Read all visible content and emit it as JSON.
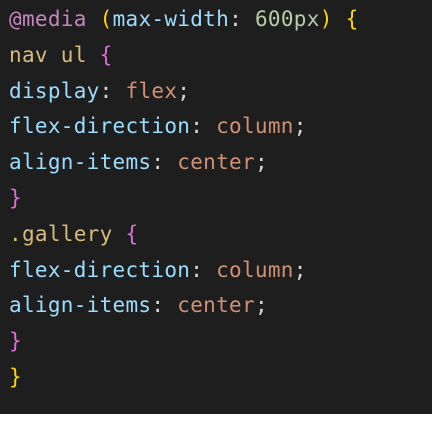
{
  "colors": {
    "background": "#1e1e1e",
    "keyword": "#c586c0",
    "property": "#9cdcfe",
    "selector": "#d7ba7d",
    "tag": "#d7ba7d",
    "value": "#ce9178",
    "number": "#b5cea8",
    "punctuation": "#d4d4d4",
    "brace_gold": "#ffd700",
    "brace_purple": "#da70d6"
  },
  "code_lines": [
    [
      {
        "text": "@media",
        "color": "#c586c0"
      },
      {
        "text": " ",
        "color": "#d4d4d4"
      },
      {
        "text": "(",
        "color": "#ffd700"
      },
      {
        "text": "max-width",
        "color": "#9cdcfe"
      },
      {
        "text": ": ",
        "color": "#d4d4d4"
      },
      {
        "text": "600px",
        "color": "#b5cea8"
      },
      {
        "text": ")",
        "color": "#ffd700"
      },
      {
        "text": " ",
        "color": "#d4d4d4"
      },
      {
        "text": "{",
        "color": "#ffd700"
      }
    ],
    [
      {
        "text": "nav ul",
        "color": "#d7ba7d"
      },
      {
        "text": " ",
        "color": "#d4d4d4"
      },
      {
        "text": "{",
        "color": "#da70d6"
      }
    ],
    [
      {
        "text": "display",
        "color": "#9cdcfe"
      },
      {
        "text": ": ",
        "color": "#d4d4d4"
      },
      {
        "text": "flex",
        "color": "#ce9178"
      },
      {
        "text": ";",
        "color": "#d4d4d4"
      }
    ],
    [
      {
        "text": "flex-direction",
        "color": "#9cdcfe"
      },
      {
        "text": ": ",
        "color": "#d4d4d4"
      },
      {
        "text": "column",
        "color": "#ce9178"
      },
      {
        "text": ";",
        "color": "#d4d4d4"
      }
    ],
    [
      {
        "text": "align-items",
        "color": "#9cdcfe"
      },
      {
        "text": ": ",
        "color": "#d4d4d4"
      },
      {
        "text": "center",
        "color": "#ce9178"
      },
      {
        "text": ";",
        "color": "#d4d4d4"
      }
    ],
    [
      {
        "text": "}",
        "color": "#da70d6"
      }
    ],
    [
      {
        "text": ".gallery",
        "color": "#d7ba7d"
      },
      {
        "text": " ",
        "color": "#d4d4d4"
      },
      {
        "text": "{",
        "color": "#da70d6"
      }
    ],
    [
      {
        "text": "flex-direction",
        "color": "#9cdcfe"
      },
      {
        "text": ": ",
        "color": "#d4d4d4"
      },
      {
        "text": "column",
        "color": "#ce9178"
      },
      {
        "text": ";",
        "color": "#d4d4d4"
      }
    ],
    [
      {
        "text": "align-items",
        "color": "#9cdcfe"
      },
      {
        "text": ": ",
        "color": "#d4d4d4"
      },
      {
        "text": "center",
        "color": "#ce9178"
      },
      {
        "text": ";",
        "color": "#d4d4d4"
      }
    ],
    [
      {
        "text": "}",
        "color": "#da70d6"
      }
    ],
    [
      {
        "text": "}",
        "color": "#ffd700"
      }
    ]
  ]
}
